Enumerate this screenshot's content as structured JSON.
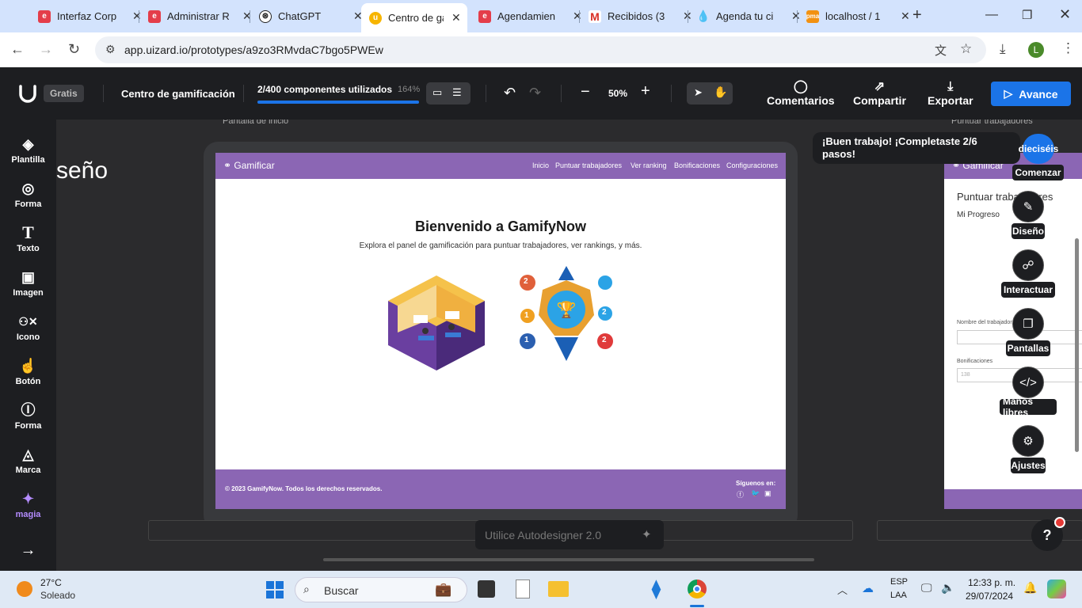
{
  "browser": {
    "tabs": [
      {
        "label": "Interfaz Corp",
        "icon": "esc-icon",
        "color": "#e43d4a"
      },
      {
        "label": "Administrar R",
        "icon": "esc-icon",
        "color": "#e43d4a"
      },
      {
        "label": "ChatGPT",
        "icon": "chatgpt-icon",
        "color": "#222222"
      },
      {
        "label": "Centro de ga",
        "icon": "uizard-icon",
        "color": "#f7b500"
      },
      {
        "label": "Agendamien",
        "icon": "esc-icon",
        "color": "#e43d4a"
      },
      {
        "label": "Recibidos (3",
        "icon": "gmail-icon",
        "color": "#d93025"
      },
      {
        "label": "Agenda tu ci",
        "icon": "drop-icon",
        "color": "#1a73e8"
      },
      {
        "label": "localhost / 1",
        "icon": "phpmyadmin-icon",
        "color": "#f29111"
      }
    ],
    "new_tab": "+",
    "url": "app.uizard.io/prototypes/a9zo3RMvdaC7bgo5PWEw",
    "profile_initial": "L"
  },
  "toolbar": {
    "plan": "Gratis",
    "project_name": "Centro de gamificación",
    "components_used": "2/400 componentes utilizados",
    "components_pct": "164%",
    "components_progress": 1.0,
    "zoom": "50%",
    "comments": "Comentarios",
    "share": "Compartir",
    "export": "Exportar",
    "upgrade": "Avance"
  },
  "sidebar": {
    "items": [
      {
        "label": "Plantilla",
        "icon": "layers-icon"
      },
      {
        "label": "Forma",
        "icon": "shapes-icon"
      },
      {
        "label": "Texto",
        "icon": "text-icon"
      },
      {
        "label": "Imagen",
        "icon": "image-icon"
      },
      {
        "label": "Icono",
        "icon": "icon-icon"
      },
      {
        "label": "Botón",
        "icon": "button-icon"
      },
      {
        "label": "Forma",
        "icon": "form-icon"
      },
      {
        "label": "Marca",
        "icon": "brand-icon"
      },
      {
        "label": "magia",
        "icon": "magic-icon"
      }
    ]
  },
  "canvas": {
    "partial_text": "seño",
    "screen1_title": "Pantalla de inicio",
    "screen2_title": "Puntuar trabajadores",
    "autodesigner_placeholder": "Utilice Autodesigner 2.0"
  },
  "screen1": {
    "brand": "Gamificar",
    "nav": [
      "Inicio",
      "Puntuar trabajadores",
      "Ver ranking",
      "Bonificaciones",
      "Configuraciones"
    ],
    "heading": "Bienvenido a GamifyNow",
    "subheading": "Explora el panel de gamificación para puntuar trabajadores, ver rankings, y más.",
    "footer_copy": "© 2023 GamifyNow. Todos los derechos reservados.",
    "footer_follow": "Síguenos en:",
    "medals": [
      "2",
      "1",
      "1",
      "2",
      "2"
    ]
  },
  "screen2": {
    "brand": "Gamificar",
    "title": "Puntuar trabajadores",
    "progress": "Mi Progreso",
    "field1_label": "Nombre del trabajador",
    "field2_label": "Bonificaciones",
    "field2_placeholder": "138"
  },
  "onboarding": {
    "message": "¡Buen trabajo! ¡Completaste 2/6 pasos!",
    "badge": "dieciséis",
    "start": "Comenzar"
  },
  "floating_menu": [
    {
      "label": "Diseño",
      "icon": "pencil-icon"
    },
    {
      "label": "Interactuar",
      "icon": "link-icon"
    },
    {
      "label": "Pantallas",
      "icon": "screens-icon"
    },
    {
      "label": "Manos libres",
      "icon": "code-icon"
    },
    {
      "label": "Ajustes",
      "icon": "gear-icon"
    }
  ],
  "help": "?",
  "taskbar": {
    "weather_temp": "27°C",
    "weather_desc": "Soleado",
    "search": "Buscar",
    "lang1": "ESP",
    "lang2": "LAA",
    "time": "12:33 p. m.",
    "date": "29/07/2024"
  },
  "colors": {
    "accent": "#1b74e8",
    "brand_purple": "#8b66b4"
  }
}
